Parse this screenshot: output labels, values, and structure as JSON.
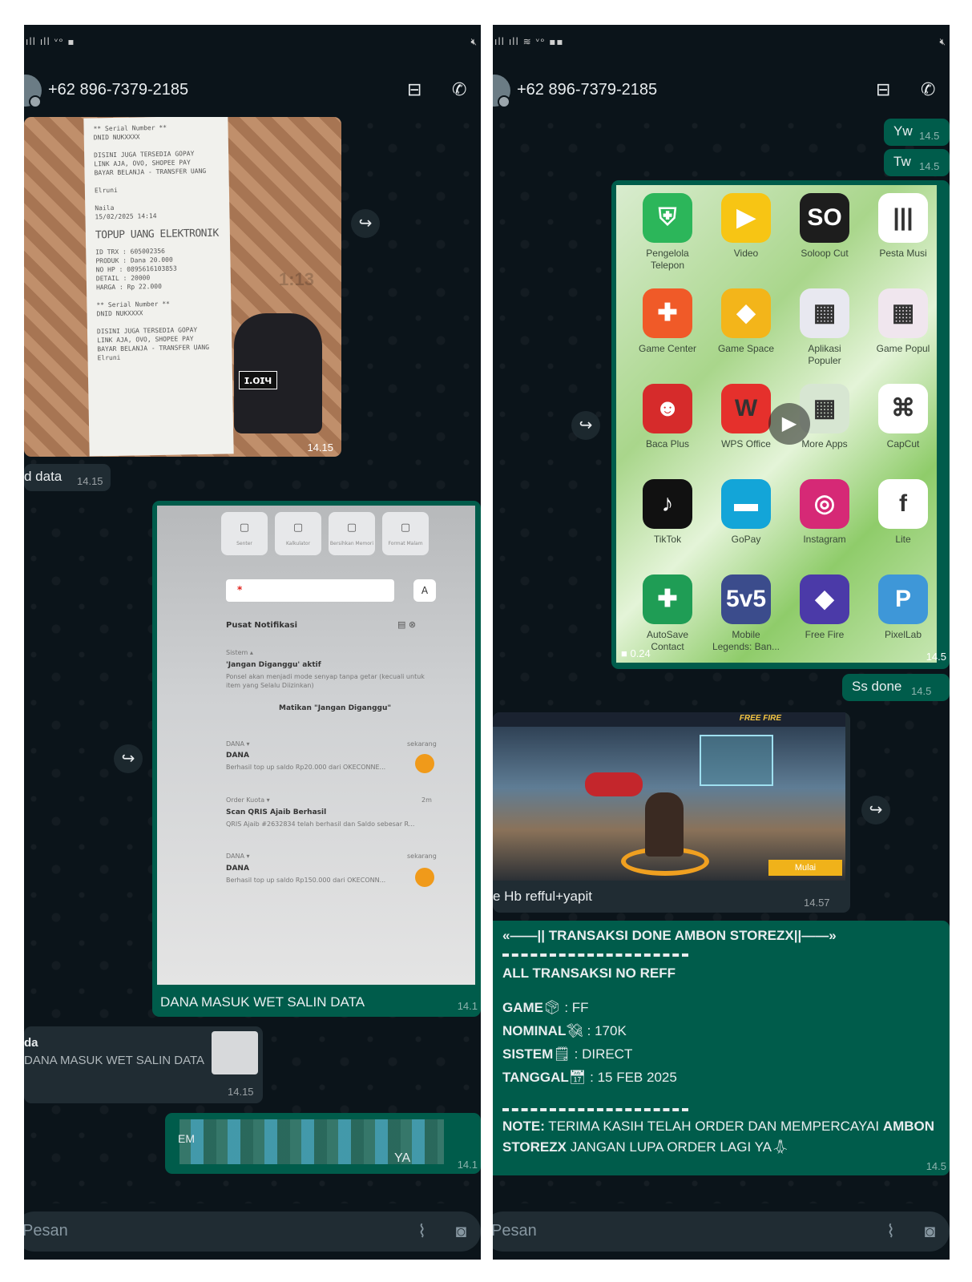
{
  "left_panel": {
    "status_bar": {
      "signal": "ıll ıll ᵛᵒ ▪",
      "mute_icon": "mute-icon"
    },
    "header": {
      "phone": "+62 896-7379-2185",
      "store_icon": "store-icon",
      "call_icon": "add-call-icon"
    },
    "receipt_image": {
      "lines": [
        "** Serial Number **",
        "DNID NUKXXXX",
        "",
        "DISINI JUGA TERSEDIA GOPAY",
        "LINK AJA, OVO, SHOPEE PAY",
        "BAYAR BELANJA - TRANSFER UANG",
        "",
        "Elruni",
        "",
        "Naila",
        "15/02/2025 14:14"
      ],
      "heading": "TOPUP UANG ELEKTRONIK",
      "details": [
        "ID TRX   : 605002356",
        "PRODUK   : Dana 20.000",
        "NO HP    : 0895616103853",
        "DETAIL   : 20000",
        "HARGA    : Rp 22.000",
        "",
        "** Serial Number **",
        "DNID NUKXXXX",
        "",
        "DISINI JUGA TERSEDIA GOPAY",
        "LINK AJA, OVO, SHOPEE PAY",
        "BAYAR BELANJA - TRANSFER UANG",
        "Elruni"
      ],
      "sandal_text": "ɪ.oɪч",
      "watermark": "1:13",
      "time": "14.15"
    },
    "msg_data": {
      "text": "d data",
      "time": "14.15"
    },
    "notif_screenshot": {
      "tiles": [
        "Senter",
        "Kalkulator",
        "Bersihkan Memori",
        "Format Malam"
      ],
      "search_marker": "*",
      "a_button": "A",
      "title": "Pusat Notifikasi",
      "dnd_app": "Sistem ▴",
      "dnd_title": "'Jangan Diganggu' aktif",
      "dnd_desc": "Ponsel akan menjadi mode senyap tanpa getar (kecuali untuk item yang Selalu Diizinkan)",
      "dnd_action": "Matikan \"Jangan Diganggu\"",
      "n1_app": "DANA ▾",
      "n1_when": "sekarang",
      "n1_title": "DANA",
      "n1_body": "Berhasil top up saldo Rp20.000 dari OKECONNE...",
      "n2_app": "Order Kuota ▾",
      "n2_when": "2m",
      "n2_title": "Scan QRIS Ajaib Berhasil",
      "n2_body": "QRIS Ajaib #2632834 telah berhasil dan Saldo sebesar R...",
      "n3_app": "DANA ▾",
      "n3_when": "sekarang",
      "n3_title": "DANA",
      "n3_body": "Berhasil top up saldo Rp150.000 dari OKECONN..."
    },
    "caption": {
      "text": "DANA MASUK WET SALIN DATA",
      "time": "14.1"
    },
    "reply": {
      "name": "da",
      "text": "DANA MASUK WET SALIN DATA",
      "time": "14.15"
    },
    "last": {
      "text": "YA",
      "time": "14.1",
      "blur_prefix": "EM"
    },
    "input": {
      "placeholder": "Pesan",
      "attach_icon": "attach-icon",
      "camera_icon": "camera-icon"
    }
  },
  "right_panel": {
    "status_bar": {
      "signal": "ıll ıll ≋ ᵛᵒ ▪▪",
      "mute_icon": "mute-icon"
    },
    "header": {
      "phone": "+62 896-7379-2185",
      "store_icon": "store-icon",
      "call_icon": "add-call-icon"
    },
    "msg_yw": {
      "text": "Yw",
      "time": "14.5"
    },
    "msg_tw": {
      "text": "Tw",
      "time": "14.5"
    },
    "apps": [
      {
        "label": "Pengelola\nTelepon",
        "color": "#2cb65a",
        "glyph": "⛨"
      },
      {
        "label": "Video",
        "color": "#f7c514",
        "glyph": "▶"
      },
      {
        "label": "Soloop Cut",
        "color": "#1d1d1d",
        "glyph": "SO"
      },
      {
        "label": "Pesta Musi",
        "color": "#ffffff",
        "glyph": "|||"
      },
      {
        "label": "Game Center",
        "color": "#f05a28",
        "glyph": "✚"
      },
      {
        "label": "Game Space",
        "color": "#f3b51a",
        "glyph": "◆"
      },
      {
        "label": "Aplikasi\nPopuler",
        "color": "#e8e8f0",
        "glyph": "▦"
      },
      {
        "label": "Game Popul",
        "color": "#f0e6ee",
        "glyph": "▦"
      },
      {
        "label": "Baca Plus",
        "color": "#d62b2b",
        "glyph": "☻"
      },
      {
        "label": "WPS Office",
        "color": "#e5302c",
        "glyph": "W"
      },
      {
        "label": "More Apps",
        "color": "#d7e6d2",
        "glyph": "▦"
      },
      {
        "label": "CapCut",
        "color": "#ffffff",
        "glyph": "⌘"
      },
      {
        "label": "TikTok",
        "color": "#111111",
        "glyph": "♪"
      },
      {
        "label": "GoPay",
        "color": "#13a5d8",
        "glyph": "▬"
      },
      {
        "label": "Instagram",
        "color": "#d62976",
        "glyph": "◎"
      },
      {
        "label": "Lite",
        "color": "#ffffff",
        "glyph": "f"
      },
      {
        "label": "AutoSave\nContact",
        "color": "#1f9d55",
        "glyph": "✚"
      },
      {
        "label": "Mobile\nLegends: Ban...",
        "color": "#3b4c8c",
        "glyph": "5v5"
      },
      {
        "label": "Free Fire",
        "color": "#4b3aa8",
        "glyph": "◆"
      },
      {
        "label": "PixelLab",
        "color": "#3e97d8",
        "glyph": "P"
      }
    ],
    "video": {
      "duration": "0.24",
      "time": "14.5",
      "play_icon": "play-icon"
    },
    "msg_ss": {
      "text": "Ss done",
      "time": "14.5"
    },
    "game": {
      "title": "FREE FIRE",
      "button": "Mulai",
      "caption": "e Hb refful+yapit",
      "time": "14.57"
    },
    "trx": {
      "title": "«——|| TRANSAKSI DONE AMBON STOREZX||——»",
      "sub": "ALL TRANSAKSI NO REFF",
      "game_label": "GAME",
      "game_val": ": FF",
      "nominal_label": "NOMINAL",
      "nominal_val": ": 170K",
      "sistem_label": "SISTEM",
      "sistem_val": ": DIRECT",
      "tanggal_label": "TANGGAL",
      "tanggal_val": ": 15 FEB 2025",
      "note_label": "NOTE:",
      "note_val": " TERIMA KASIH TELAH ORDER DAN MEMPERCAYAI ",
      "note_bold": "AMBON STOREZX",
      "note_tail": " JANGAN LUPA ORDER LAGI YA",
      "time": "14.5"
    },
    "input": {
      "placeholder": "Pesan",
      "attach_icon": "attach-icon",
      "camera_icon": "camera-icon"
    }
  },
  "colors": {
    "bg": "#0b141a",
    "incoming": "#202c33",
    "outgoing": "#005c4b",
    "text": "#e9edef"
  }
}
